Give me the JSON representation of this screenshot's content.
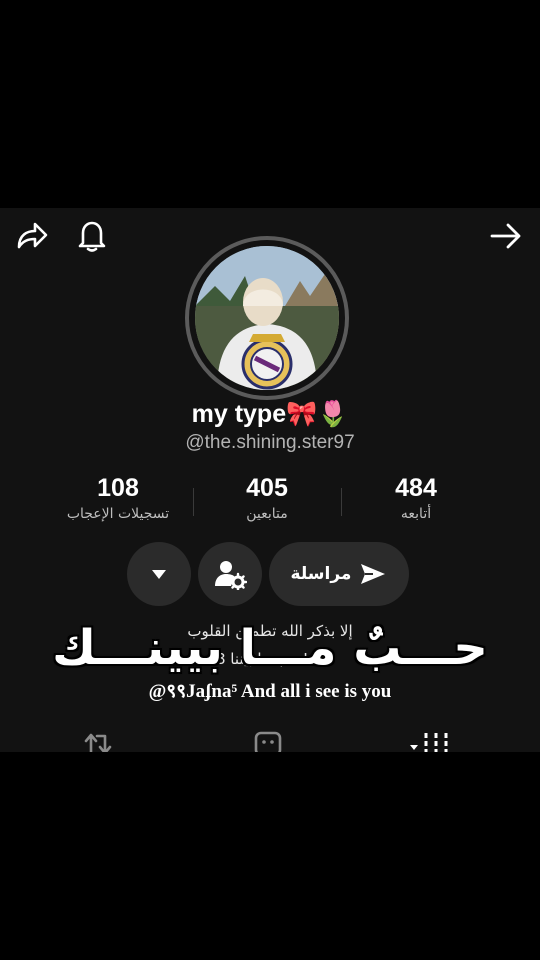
{
  "profile": {
    "display_name": "my type🎀🌷",
    "username": "@the.shining.ster97"
  },
  "stats": {
    "following": {
      "value": "484",
      "label": "أتابعه"
    },
    "followers": {
      "value": "405",
      "label": "متابعين"
    },
    "likes": {
      "value": "108",
      "label": "تسجيلات الإعجاب"
    }
  },
  "actions": {
    "message_label": "مراسلة"
  },
  "bio": {
    "line1": "إلا بذكر الله تطمئن القلوب",
    "line2": "حب ما بيننا 8 US",
    "line3": "@९९Jaʄna⁵ And all i see is you"
  },
  "overlay_caption": "حـــبٌ مـــا بيينـــك",
  "icons": {
    "share": "share-icon",
    "bell": "bell-icon",
    "forward": "arrow-right-icon",
    "settings": "person-gear-icon",
    "dropdown": "caret-down-icon",
    "send": "send-icon",
    "repost_tab": "repost-icon",
    "liked_tab": "private-likes-icon",
    "grid_tab": "grid-icon"
  },
  "colors": {
    "background": "#121212",
    "button_bg": "#2b2b2b",
    "secondary_text": "#b3b3b3",
    "ring": "#5b5b5b"
  }
}
